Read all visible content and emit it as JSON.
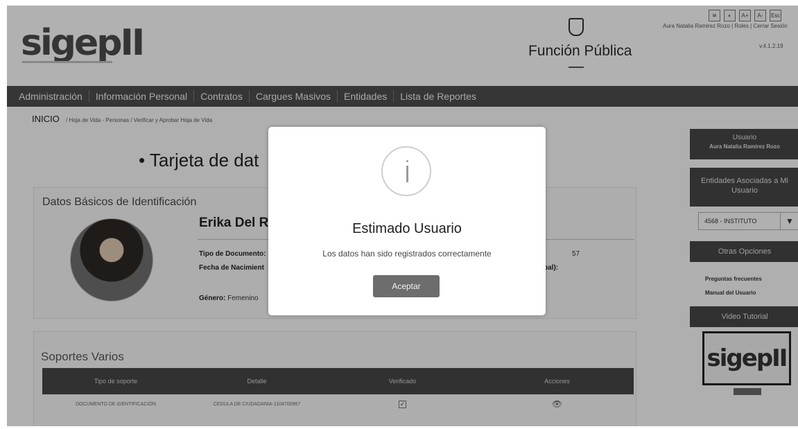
{
  "header": {
    "logo": "sigepII",
    "org_name": "Función Pública",
    "accessibility_tools": [
      "≋",
      "◐",
      "A+",
      "A-",
      "Esc"
    ],
    "user_info": "Aura Natalia Ramirez Rozo | Roles | Cerrar Sesión",
    "version": "v.4.1.2.19"
  },
  "nav": {
    "items": [
      "Administración",
      "Información Personal",
      "Contratos",
      "Cargues Masivos",
      "Entidades",
      "Lista de Reportes"
    ]
  },
  "breadcrumb": {
    "home": "INICIO",
    "trail": "/ Hoja de Vida - Personas  / Verificar y Aprobar Hoja de Vida"
  },
  "main": {
    "title": "• Tarjeta de dat",
    "datos_basicos": {
      "section_title": "Datos Básicos de Identificación",
      "name": "Erika Del R",
      "tipo_documento_label": "Tipo de Documento:",
      "fecha_nacimiento_label": "Fecha de Nacimient",
      "genero_label": "Género:",
      "genero_value": "Femenino",
      "right_fragment_1": "57",
      "right_fragment_2": "pal):"
    },
    "soportes": {
      "section_title": "Soportes Varios",
      "columns": [
        "Tipo de soporte",
        "Detalle",
        "Verificado",
        "Acciones"
      ],
      "rows": [
        {
          "tipo": "DOCUMENTO DE IDENTIFICACIÓN",
          "detalle": "CEDULA DE CIUDADANIA-1104700967",
          "verificado": "✓",
          "acciones": "👁"
        }
      ]
    }
  },
  "sidebar": {
    "usuario_label": "Usuario",
    "usuario_name": "Aura Natalia Ramirez Rozo",
    "entidades_label": "Entidades Asociadas a Mi Usuario",
    "entidad_selected": "4568 - INSTITUTO",
    "otras_opciones_label": "Otras Opciones",
    "links": [
      "Preguntas frecuentes",
      "Manual del Usuario"
    ],
    "video_label": "Video Tutorial",
    "video_logo": "sigepII"
  },
  "modal": {
    "icon": "info-icon",
    "title": "Estimado Usuario",
    "message": "Los datos han sido registrados correctamente",
    "button": "Aceptar"
  }
}
